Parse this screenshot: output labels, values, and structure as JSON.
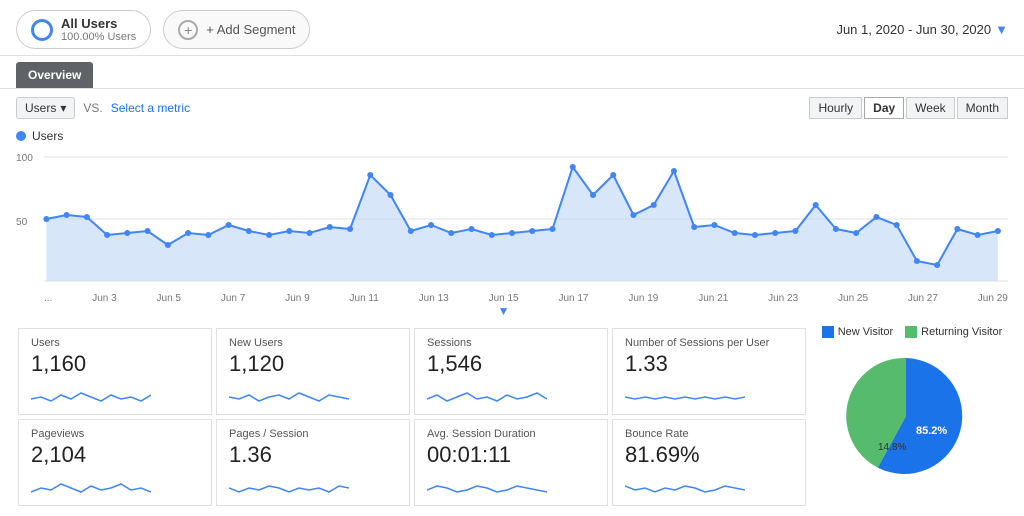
{
  "header": {
    "segment": {
      "name": "All Users",
      "pct": "100.00% Users"
    },
    "add_segment_label": "+ Add Segment",
    "date_range": "Jun 1, 2020 - Jun 30, 2020"
  },
  "tabs": [
    "Overview"
  ],
  "controls": {
    "metric": "Users",
    "vs_label": "VS.",
    "select_metric": "Select a metric",
    "time_buttons": [
      "Hourly",
      "Day",
      "Week",
      "Month"
    ],
    "active_time": "Day"
  },
  "chart": {
    "legend_label": "Users",
    "y_labels": [
      "100",
      "50"
    ],
    "x_labels": [
      "...",
      "Jun 3",
      "Jun 5",
      "Jun 7",
      "Jun 9",
      "Jun 11",
      "Jun 13",
      "Jun 15",
      "Jun 17",
      "Jun 19",
      "Jun 21",
      "Jun 23",
      "Jun 25",
      "Jun 27",
      "Jun 29"
    ]
  },
  "stats": [
    {
      "label": "Users",
      "value": "1,160"
    },
    {
      "label": "New Users",
      "value": "1,120"
    },
    {
      "label": "Sessions",
      "value": "1,546"
    },
    {
      "label": "Number of Sessions per User",
      "value": "1.33"
    },
    {
      "label": "Pageviews",
      "value": "2,104"
    },
    {
      "label": "Pages / Session",
      "value": "1.36"
    },
    {
      "label": "Avg. Session Duration",
      "value": "00:01:11"
    },
    {
      "label": "Bounce Rate",
      "value": "81.69%"
    }
  ],
  "pie": {
    "legend": [
      {
        "label": "New Visitor",
        "color": "#1a73e8"
      },
      {
        "label": "Returning Visitor",
        "color": "#57bb6e"
      }
    ],
    "segments": [
      {
        "label": "85.2%",
        "pct": 85.2,
        "color": "#1a73e8"
      },
      {
        "label": "14.8%",
        "pct": 14.8,
        "color": "#57bb6e"
      }
    ]
  },
  "colors": {
    "accent_blue": "#4285f4",
    "chart_fill": "#c6dcf7",
    "chart_line": "#4285f4"
  }
}
